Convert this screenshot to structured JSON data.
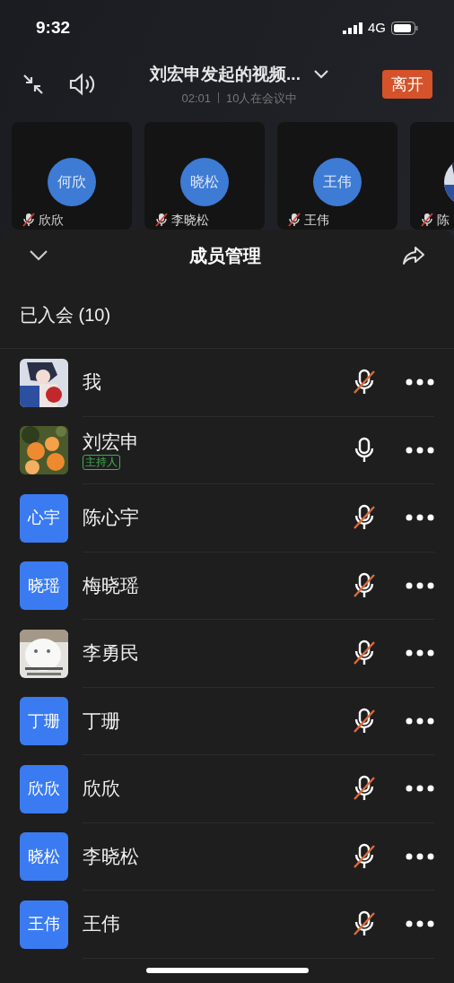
{
  "status_bar": {
    "time": "9:32",
    "network": "4G"
  },
  "call": {
    "title": "刘宏申发起的视频...",
    "duration": "02:01",
    "participants": "10人在会议中",
    "leave_button": "离开"
  },
  "tiles": [
    {
      "name": "欣欣",
      "avatar_text": "何欣",
      "kind": "initials"
    },
    {
      "name": "李晓松",
      "avatar_text": "晓松",
      "kind": "initials"
    },
    {
      "name": "王伟",
      "avatar_text": "王伟",
      "kind": "initials"
    },
    {
      "name": "陈",
      "kind": "picture"
    }
  ],
  "sheet": {
    "title": "成员管理",
    "section": "已入会 (10)"
  },
  "members": [
    {
      "name": "我",
      "kind": "picture",
      "muted": true
    },
    {
      "name": "刘宏申",
      "kind": "picture",
      "badge": "主持人",
      "muted": false
    },
    {
      "name": "陈心宇",
      "kind": "initials",
      "avatar_text": "心宇",
      "muted": true
    },
    {
      "name": "梅晓瑶",
      "kind": "initials",
      "avatar_text": "晓瑶",
      "muted": true
    },
    {
      "name": "李勇民",
      "kind": "picture",
      "muted": true
    },
    {
      "name": "丁珊",
      "kind": "initials",
      "avatar_text": "丁珊",
      "muted": true
    },
    {
      "name": "欣欣",
      "kind": "initials",
      "avatar_text": "欣欣",
      "muted": true
    },
    {
      "name": "李晓松",
      "kind": "initials",
      "avatar_text": "晓松",
      "muted": true
    },
    {
      "name": "王伟",
      "kind": "initials",
      "avatar_text": "王伟",
      "muted": true
    }
  ]
}
